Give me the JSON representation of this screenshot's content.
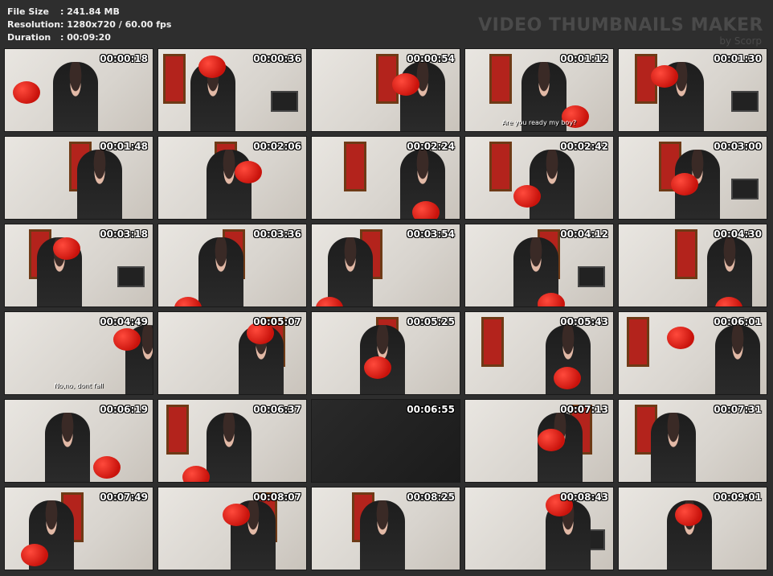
{
  "meta": {
    "file_size_label": "File Size",
    "file_size_value": ": 241.84 MB",
    "resolution_label": "Resolution",
    "resolution_value": ": 1280x720 / 60.00 fps",
    "duration_label": "Duration",
    "duration_value": ": 00:09:20"
  },
  "brand": {
    "title": "VIDEO THUMBNAILS MAKER",
    "subtitle": "by Scorp"
  },
  "thumbnails": [
    {
      "time": "00:00:18",
      "caption": ""
    },
    {
      "time": "00:00:36",
      "caption": ""
    },
    {
      "time": "00:00:54",
      "caption": ""
    },
    {
      "time": "00:01:12",
      "caption": "Are you ready my boy?"
    },
    {
      "time": "00:01:30",
      "caption": ""
    },
    {
      "time": "00:01:48",
      "caption": ""
    },
    {
      "time": "00:02:06",
      "caption": ""
    },
    {
      "time": "00:02:24",
      "caption": ""
    },
    {
      "time": "00:02:42",
      "caption": ""
    },
    {
      "time": "00:03:00",
      "caption": ""
    },
    {
      "time": "00:03:18",
      "caption": ""
    },
    {
      "time": "00:03:36",
      "caption": ""
    },
    {
      "time": "00:03:54",
      "caption": ""
    },
    {
      "time": "00:04:12",
      "caption": ""
    },
    {
      "time": "00:04:30",
      "caption": ""
    },
    {
      "time": "00:04:49",
      "caption": "No,no, dont fall"
    },
    {
      "time": "00:05:07",
      "caption": ""
    },
    {
      "time": "00:05:25",
      "caption": ""
    },
    {
      "time": "00:05:43",
      "caption": ""
    },
    {
      "time": "00:06:01",
      "caption": ""
    },
    {
      "time": "00:06:19",
      "caption": ""
    },
    {
      "time": "00:06:37",
      "caption": ""
    },
    {
      "time": "00:06:55",
      "caption": ""
    },
    {
      "time": "00:07:13",
      "caption": ""
    },
    {
      "time": "00:07:31",
      "caption": ""
    },
    {
      "time": "00:07:49",
      "caption": ""
    },
    {
      "time": "00:08:07",
      "caption": ""
    },
    {
      "time": "00:08:25",
      "caption": ""
    },
    {
      "time": "00:08:43",
      "caption": ""
    },
    {
      "time": "00:09:01",
      "caption": ""
    }
  ],
  "colors": {
    "background": "#2e2e2e",
    "glove_red": "#c9130c",
    "text": "#ffffff"
  }
}
